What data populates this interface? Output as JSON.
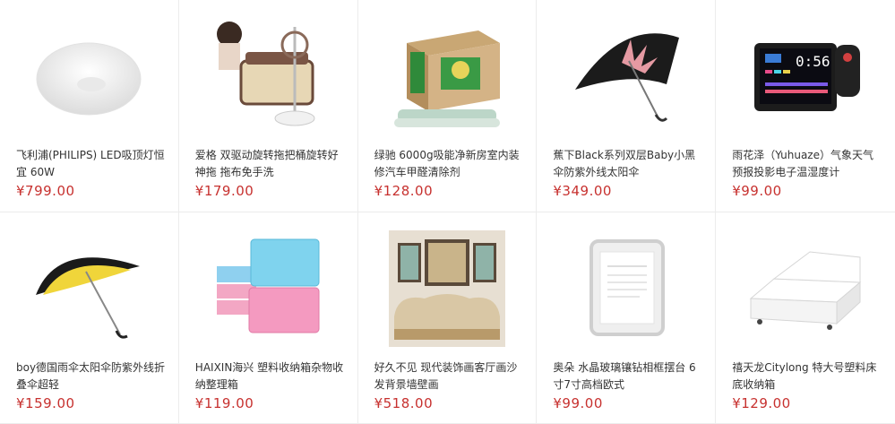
{
  "products": [
    {
      "title": "飞利浦(PHILIPS) LED吸顶灯恒宜 60W",
      "price": "¥799.00",
      "icon": "ceiling-lamp-image"
    },
    {
      "title": "爱格 双驱动旋转拖把桶旋转好神拖 拖布免手洗",
      "price": "¥179.00",
      "icon": "mop-bucket-image"
    },
    {
      "title": "绿驰 6000g吸能净新房室内装修汽车甲醛清除剂",
      "price": "¥128.00",
      "icon": "charcoal-box-image"
    },
    {
      "title": "蕉下Black系列双层Baby小黑伞防紫外线太阳伞",
      "price": "¥349.00",
      "icon": "black-umbrella-image"
    },
    {
      "title": "雨花泽（Yuhuaze）气象天气预报投影电子温湿度计",
      "price": "¥99.00",
      "icon": "weather-clock-image"
    },
    {
      "title": "boy德国雨伞太阳伞防紫外线折叠伞超轻",
      "price": "¥159.00",
      "icon": "yellow-umbrella-image"
    },
    {
      "title": "HAIXIN海兴 塑料收纳箱杂物收纳整理箱",
      "price": "¥119.00",
      "icon": "storage-boxes-image"
    },
    {
      "title": "好久不见 现代装饰画客厅画沙发背景墙壁画",
      "price": "¥518.00",
      "icon": "wall-painting-image"
    },
    {
      "title": "奥朵 水晶玻璃镶钻相框摆台 6寸7寸高档欧式",
      "price": "¥99.00",
      "icon": "photo-frame-image"
    },
    {
      "title": "禧天龙Citylong 特大号塑料床底收纳箱",
      "price": "¥129.00",
      "icon": "underbed-box-image"
    }
  ]
}
